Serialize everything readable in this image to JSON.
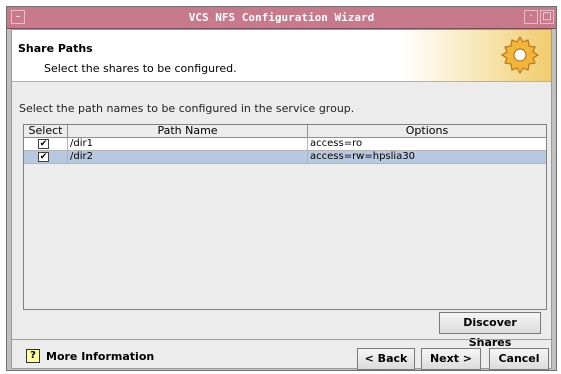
{
  "window": {
    "title": "VCS NFS Configuration Wizard",
    "menu_glyph": "–",
    "minimize_glyph": "·",
    "maximize_glyph": "□"
  },
  "header": {
    "title": "Share Paths",
    "subtitle": "Select the shares to be configured.",
    "icon": "gear-icon"
  },
  "instruction": "Select the path names to be configured in the service group.",
  "table": {
    "columns": [
      "Select",
      "Path Name",
      "Options"
    ],
    "rows": [
      {
        "checked": true,
        "check_glyph": "✔",
        "path": "/dir1",
        "options": "access=ro",
        "selected": false
      },
      {
        "checked": true,
        "check_glyph": "✔",
        "path": "/dir2",
        "options": "access=rw=hpslia30",
        "selected": true
      }
    ]
  },
  "buttons": {
    "discover": "Discover Shares",
    "back": "< Back",
    "next": "Next >",
    "cancel": "Cancel"
  },
  "footer": {
    "more_info": "More Information",
    "help_glyph": "?"
  },
  "colors": {
    "titlebar": "#c87a8c",
    "selection": "#b8c8e0"
  }
}
